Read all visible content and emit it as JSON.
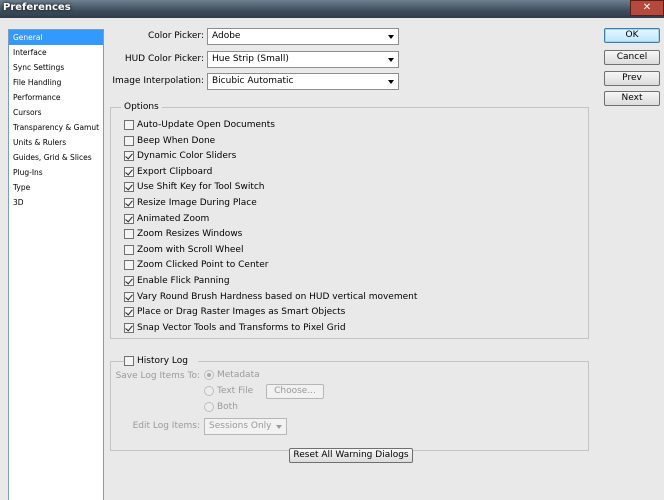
{
  "window": {
    "title": "Preferences",
    "close_glyph": "✕"
  },
  "categories": [
    {
      "label": "General",
      "selected": true
    },
    {
      "label": "Interface"
    },
    {
      "label": "Sync Settings"
    },
    {
      "label": "File Handling"
    },
    {
      "label": "Performance"
    },
    {
      "label": "Cursors"
    },
    {
      "label": "Transparency & Gamut"
    },
    {
      "label": "Units & Rulers"
    },
    {
      "label": "Guides, Grid & Slices"
    },
    {
      "label": "Plug-Ins"
    },
    {
      "label": "Type"
    },
    {
      "label": "3D"
    }
  ],
  "fields": {
    "color_picker": {
      "label": "Color Picker:",
      "value": "Adobe"
    },
    "hud_color_picker": {
      "label": "HUD Color Picker:",
      "value": "Hue Strip (Small)"
    },
    "image_interpolation": {
      "label": "Image Interpolation:",
      "value": "Bicubic Automatic"
    }
  },
  "options": {
    "title": "Options",
    "items": [
      {
        "label": "Auto-Update Open Documents",
        "checked": false
      },
      {
        "label": "Beep When Done",
        "checked": false
      },
      {
        "label": "Dynamic Color Sliders",
        "checked": true
      },
      {
        "label": "Export Clipboard",
        "checked": true
      },
      {
        "label": "Use Shift Key for Tool Switch",
        "checked": true
      },
      {
        "label": "Resize Image During Place",
        "checked": true
      },
      {
        "label": "Animated Zoom",
        "checked": true
      },
      {
        "label": "Zoom Resizes Windows",
        "checked": false
      },
      {
        "label": "Zoom with Scroll Wheel",
        "checked": false
      },
      {
        "label": "Zoom Clicked Point to Center",
        "checked": false
      },
      {
        "label": "Enable Flick Panning",
        "checked": true
      },
      {
        "label": "Vary Round Brush Hardness based on HUD vertical movement",
        "checked": true
      },
      {
        "label": "Place or Drag Raster Images as Smart Objects",
        "checked": true
      },
      {
        "label": "Snap Vector Tools and Transforms to Pixel Grid",
        "checked": true
      }
    ]
  },
  "history_log": {
    "label": "History Log",
    "checked": false,
    "save_to_label": "Save Log Items To:",
    "radios": [
      {
        "label": "Metadata",
        "checked": true
      },
      {
        "label": "Text File",
        "checked": false
      },
      {
        "label": "Both",
        "checked": false
      }
    ],
    "choose_label": "Choose...",
    "edit_items_label": "Edit Log Items:",
    "edit_items_value": "Sessions Only"
  },
  "buttons": {
    "ok": "OK",
    "cancel": "Cancel",
    "prev": "Prev",
    "next": "Next",
    "reset_warnings": "Reset All Warning Dialogs"
  },
  "colors": {
    "selection": "#3399ff",
    "titlebar": "#3d4d5c"
  }
}
